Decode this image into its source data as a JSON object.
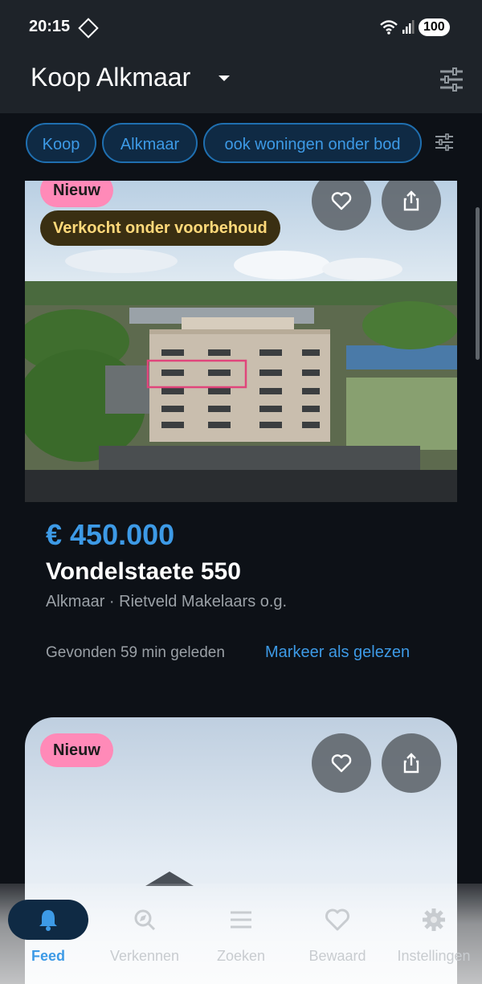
{
  "status_bar": {
    "time": "20:15",
    "battery": "100"
  },
  "app_bar": {
    "title": "Koop Alkmaar"
  },
  "filter_chips": [
    "Koop",
    "Alkmaar",
    "ook woningen onder bod"
  ],
  "listings": [
    {
      "badge": "Nieuw",
      "status": "Verkocht onder voorbehoud",
      "price": "€ 450.000",
      "address": "Vondelstaete 550",
      "location": "Alkmaar · Rietveld Makelaars o.g.",
      "found": "Gevonden 59 min geleden",
      "mark_read": "Markeer als gelezen"
    },
    {
      "badge": "Nieuw"
    }
  ],
  "bottom_nav": [
    {
      "label": "Feed",
      "icon": "bell-icon",
      "active": true
    },
    {
      "label": "Verkennen",
      "icon": "explore-icon",
      "active": false
    },
    {
      "label": "Zoeken",
      "icon": "tune-icon",
      "active": false
    },
    {
      "label": "Bewaard",
      "icon": "heart-icon",
      "active": false
    },
    {
      "label": "Instellingen",
      "icon": "gear-icon",
      "active": false
    }
  ],
  "colors": {
    "accent": "#3d9ae6",
    "badge_new": "#ff8ab8",
    "badge_sold_text": "#ffd97a",
    "background": "#0d1117"
  }
}
